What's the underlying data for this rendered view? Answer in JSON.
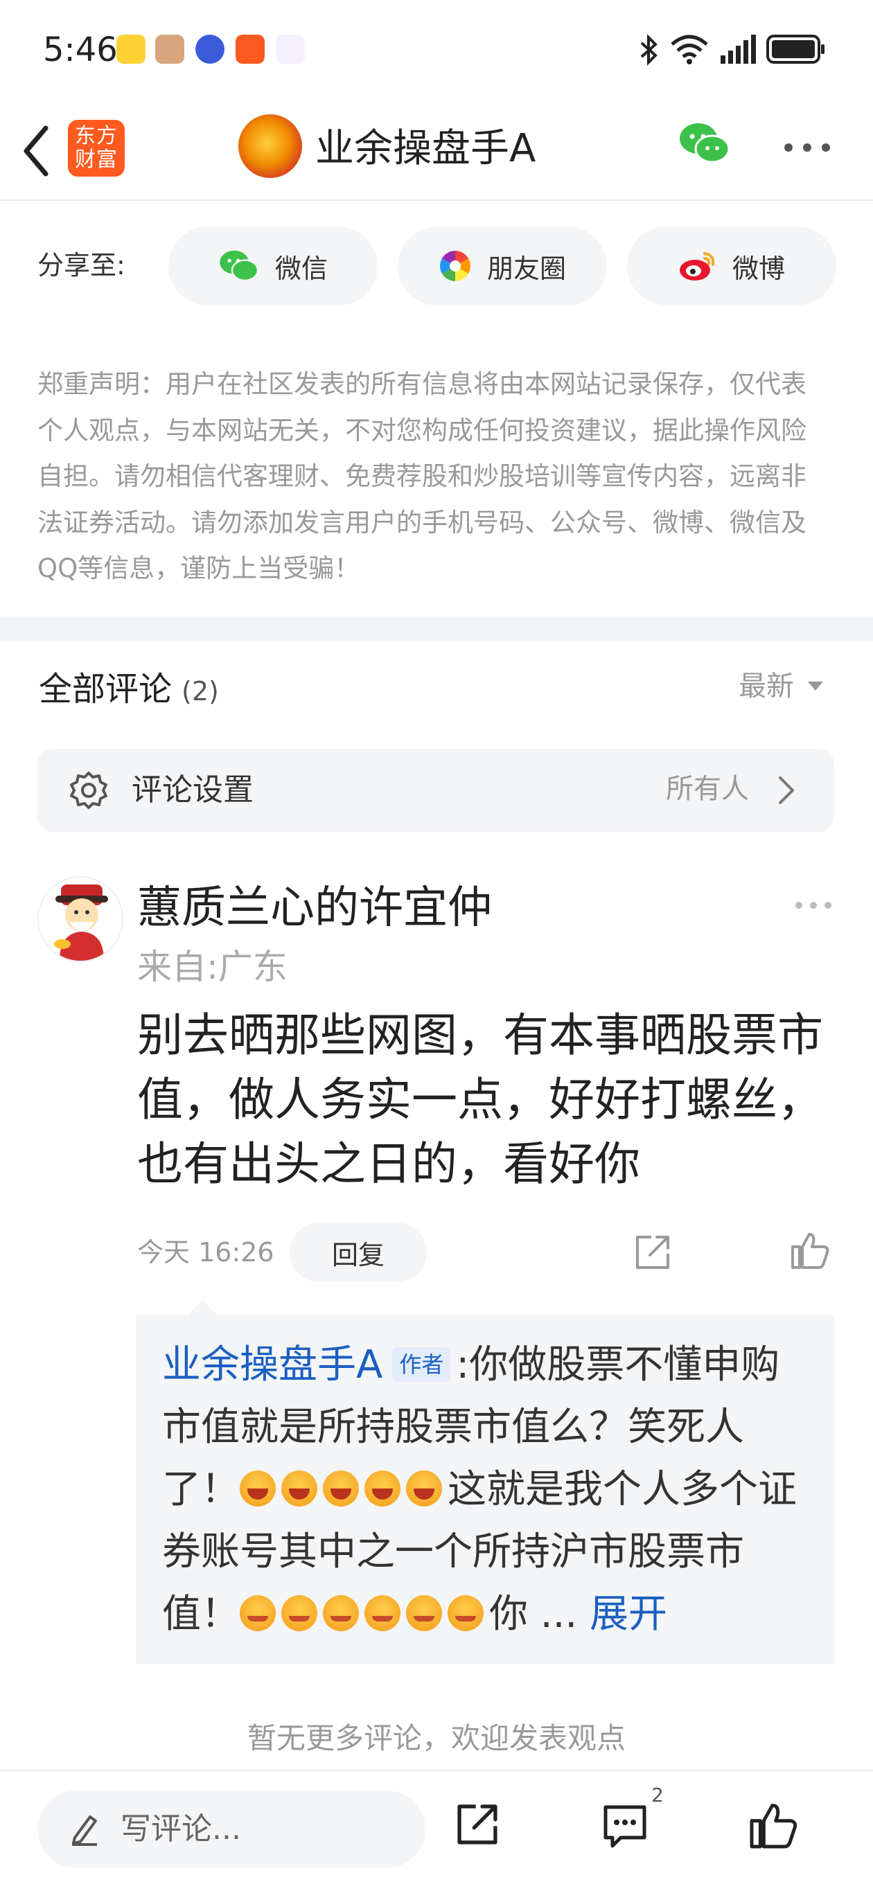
{
  "status_bar": {
    "time": "5:46",
    "notification_icons": [
      "weibo-icon",
      "avatar-icon",
      "tieba-icon",
      "app-icon",
      "video-icon"
    ],
    "system_icons": [
      "bluetooth-icon",
      "wifi-icon",
      "signal-icon",
      "battery-icon"
    ]
  },
  "nav": {
    "back_icon": "chevron-left-icon",
    "app_logo_text": "东方财富",
    "title": "业余操盘手A",
    "more_icon": "more-horizontal-icon",
    "wechat_icon": "wechat-icon"
  },
  "share": {
    "label": "分享至:",
    "targets": [
      {
        "label": "微信",
        "icon": "wechat-icon"
      },
      {
        "label": "朋友圈",
        "icon": "moments-icon"
      },
      {
        "label": "微博",
        "icon": "weibo-icon"
      }
    ]
  },
  "disclaimer": "郑重声明：用户在社区发表的所有信息将由本网站记录保存，仅代表个人观点，与本网站无关，不对您构成任何投资建议，据此操作风险自担。请勿相信代客理财、免费荐股和炒股培训等宣传内容，远离非法证券活动。请勿添加发言用户的手机号码、公众号、微博、微信及QQ等信息，谨防上当受骗！",
  "comments_header": {
    "title": "全部评论",
    "count": "(2)",
    "sort_label": "最新"
  },
  "settings": {
    "label": "评论设置",
    "value": "所有人"
  },
  "comment": {
    "username": "蕙质兰心的许宜仲",
    "location": "来自:广东",
    "body": "别去晒那些网图，有本事晒股票市值，做人务实一点，好好打螺丝，也有出头之日的，看好你",
    "time": "今天 16:26",
    "reply_label": "回复"
  },
  "reply": {
    "author": "业余操盘手A",
    "author_tag": "作者",
    "text_part1": ":你做股票不懂申购市值就是所持股票市值么？笑死人了！",
    "text_part2": "这就是我个人多个证券账号其中之一个所持沪市股票市值！",
    "text_part3": "你 ...",
    "expand_label": "展开",
    "laugh_emoji_count": 5,
    "blush_emoji_count": 6
  },
  "no_more": "暂无更多评论，欢迎发表观点",
  "bottom_bar": {
    "input_placeholder": "写评论...",
    "comment_count_badge": "2"
  },
  "colors": {
    "link_blue": "#1b5fc1",
    "brand_orange": "#ff5a1f",
    "gray_bg": "#f4f5f7"
  }
}
